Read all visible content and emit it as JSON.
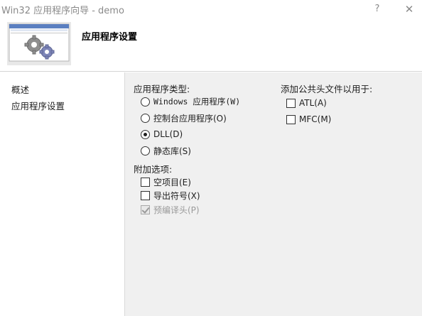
{
  "window": {
    "title": "Win32 应用程序向导 - demo",
    "help_label": "?",
    "close_label": "✕"
  },
  "header": {
    "title": "应用程序设置",
    "image_icon": "wizard-gears-icon"
  },
  "sidebar": {
    "items": [
      {
        "label": "概述"
      },
      {
        "label": "应用程序设置"
      }
    ]
  },
  "app_type": {
    "label": "应用程序类型:",
    "options": [
      {
        "label": "Windows 应用程序(W)",
        "selected": false
      },
      {
        "label": "控制台应用程序(O)",
        "selected": false
      },
      {
        "label": "DLL(D)",
        "selected": true
      },
      {
        "label": "静态库(S)",
        "selected": false
      }
    ]
  },
  "additional": {
    "label": "附加选项:",
    "options": [
      {
        "label": "空项目(E)",
        "checked": false,
        "enabled": true
      },
      {
        "label": "导出符号(X)",
        "checked": false,
        "enabled": true
      },
      {
        "label": "预编译头(P)",
        "checked": true,
        "enabled": false
      }
    ]
  },
  "common_headers": {
    "label": "添加公共头文件以用于:",
    "options": [
      {
        "label": "ATL(A)",
        "checked": false
      },
      {
        "label": "MFC(M)",
        "checked": false
      }
    ]
  }
}
